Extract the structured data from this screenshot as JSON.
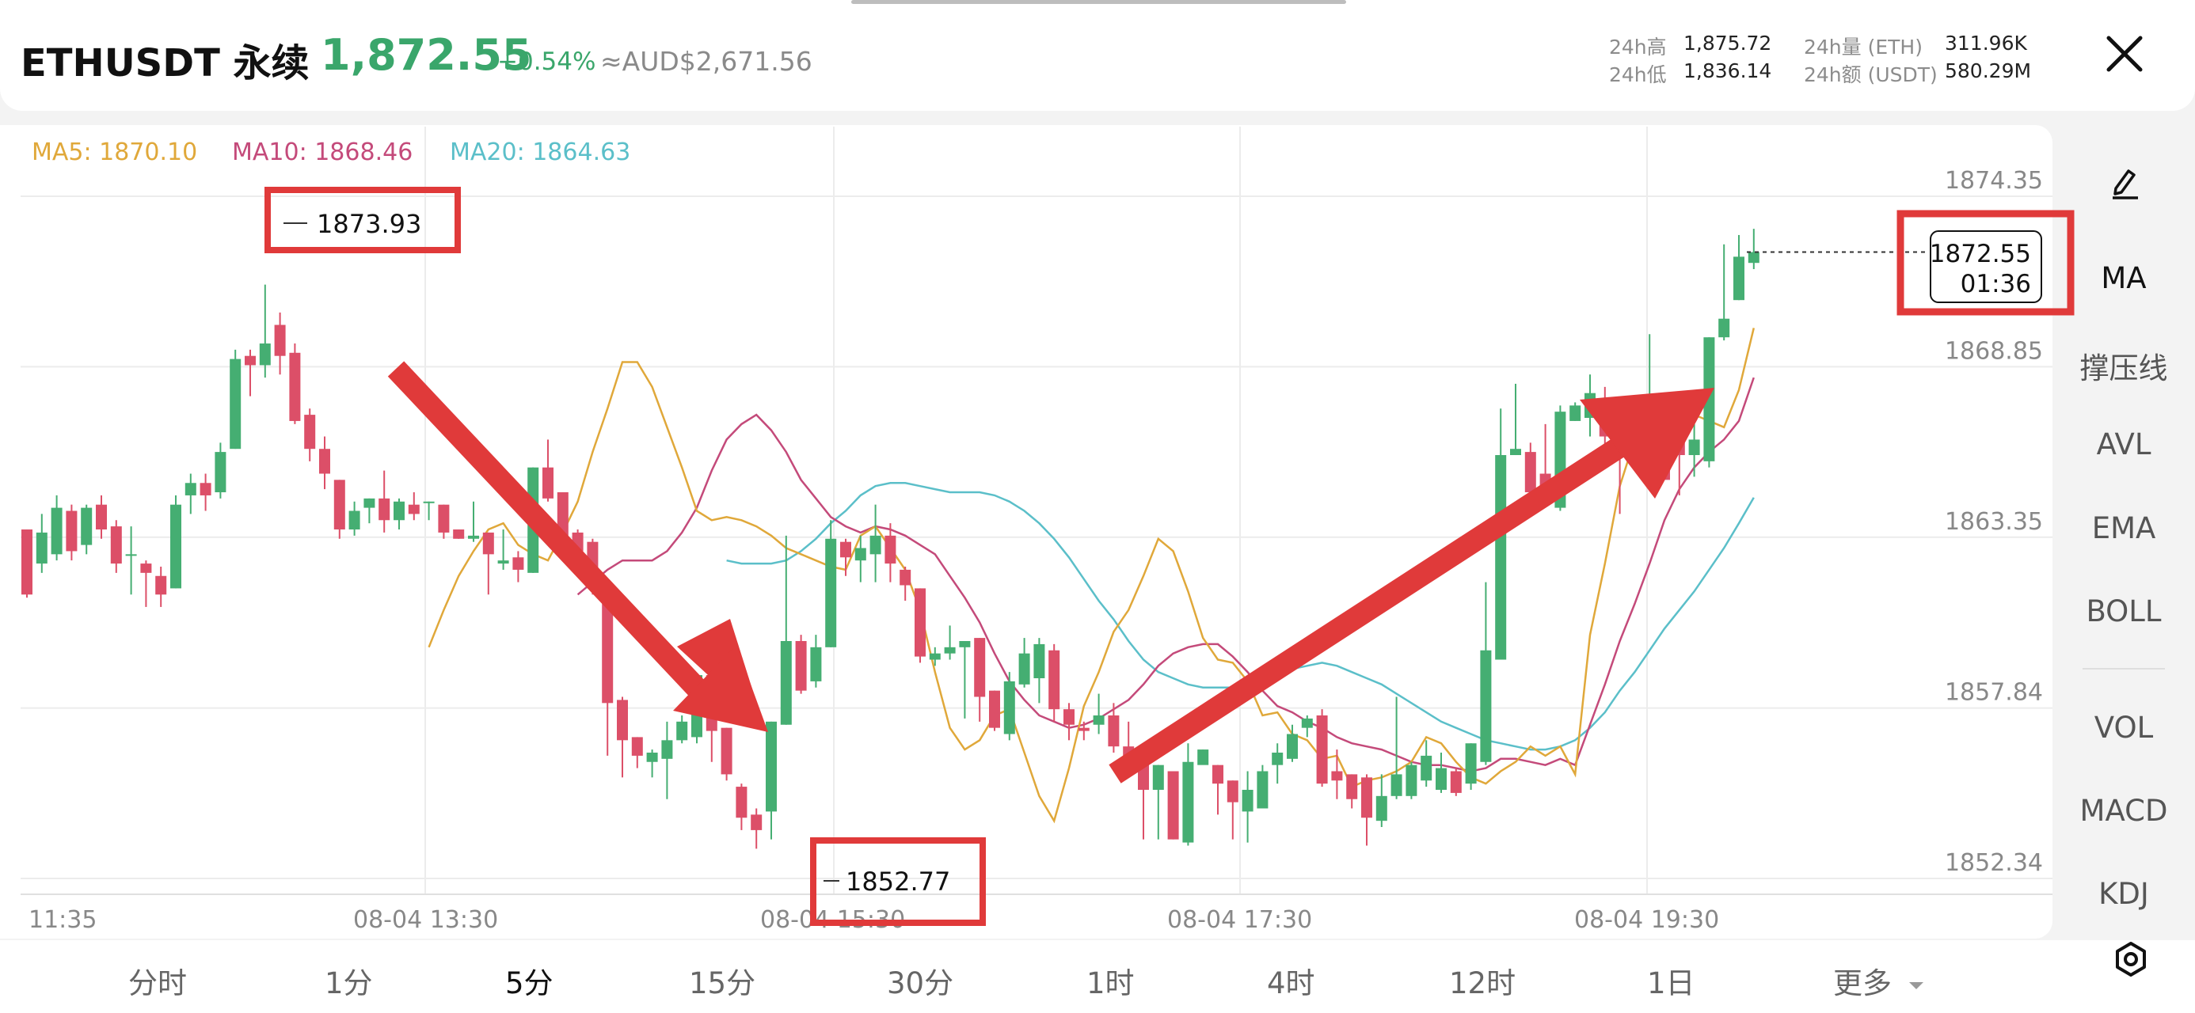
{
  "header": {
    "symbol": "ETHUSDT 永续",
    "price": "1,872.55",
    "change": "+0.54%",
    "aud": "≈AUD$2,671.56",
    "stats": [
      {
        "label": "24h高",
        "value": "1,875.72"
      },
      {
        "label": "24h低",
        "value": "1,836.14"
      },
      {
        "label": "24h量 (ETH)",
        "value": "311.96K"
      },
      {
        "label": "24h额 (USDT)",
        "value": "580.29M"
      }
    ]
  },
  "ma_legend": [
    {
      "label": "MA5: 1870.10",
      "color": "#e0a83a"
    },
    {
      "label": "MA10: 1868.46",
      "color": "#c44a7a"
    },
    {
      "label": "MA20: 1864.63",
      "color": "#5bbfc9"
    }
  ],
  "annotations": {
    "high_label": "1873.93",
    "low_label": "1852.77",
    "last_price": "1872.55",
    "countdown": "01:36"
  },
  "side_menu": [
    "MA",
    "撑压线",
    "AVL",
    "EMA",
    "BOLL",
    "VOL",
    "MACD",
    "KDJ"
  ],
  "timeframes": [
    "分时",
    "1分",
    "5分",
    "15分",
    "30分",
    "1时",
    "4时",
    "12时",
    "1日",
    "更多"
  ],
  "active_timeframe": "5分",
  "colors": {
    "up": "#45ae72",
    "down": "#dc4f68",
    "accent": "#3aa66b",
    "highlight": "#e03a3a"
  },
  "icons": [
    "pencil-icon",
    "close-icon",
    "settings-icon",
    "caret-down-icon"
  ],
  "chart_data": {
    "type": "candlestick",
    "x_ticks": [
      "11:35",
      "08-04 13:30",
      "08-04 15:30",
      "08-04 17:30",
      "08-04 19:30"
    ],
    "y_ticks": [
      "1874.35",
      "1868.85",
      "1863.35",
      "1857.84",
      "1852.34"
    ],
    "ylim": [
      1852.34,
      1874.35
    ],
    "candles": [
      [
        1863.6,
        1861.5,
        1863.6,
        1861.4
      ],
      [
        1862.5,
        1863.5,
        1864.1,
        1862.2
      ],
      [
        1862.8,
        1864.3,
        1864.7,
        1862.6
      ],
      [
        1864.2,
        1862.9,
        1864.4,
        1862.6
      ],
      [
        1863.1,
        1864.3,
        1864.4,
        1862.8
      ],
      [
        1864.4,
        1863.6,
        1864.7,
        1863.3
      ],
      [
        1863.7,
        1862.5,
        1863.9,
        1862.2
      ],
      [
        1862.8,
        1862.8,
        1863.7,
        1861.5
      ],
      [
        1862.5,
        1862.2,
        1862.6,
        1861.1
      ],
      [
        1862.1,
        1861.5,
        1862.4,
        1861.1
      ],
      [
        1861.7,
        1864.4,
        1864.7,
        1861.7
      ],
      [
        1864.7,
        1865.1,
        1865.4,
        1864.1
      ],
      [
        1865.1,
        1864.7,
        1865.4,
        1864.2
      ],
      [
        1864.8,
        1866.1,
        1866.4,
        1864.6
      ],
      [
        1866.2,
        1869.1,
        1869.4,
        1866.2
      ],
      [
        1869.2,
        1868.9,
        1869.4,
        1867.9
      ],
      [
        1868.9,
        1869.6,
        1871.5,
        1868.5
      ],
      [
        1870.2,
        1869.2,
        1870.6,
        1868.6
      ],
      [
        1869.3,
        1867.1,
        1869.6,
        1867.0
      ],
      [
        1867.3,
        1866.2,
        1867.5,
        1865.8
      ],
      [
        1866.2,
        1865.4,
        1866.6,
        1864.9
      ],
      [
        1865.2,
        1863.6,
        1865.2,
        1863.3
      ],
      [
        1863.6,
        1864.2,
        1864.5,
        1863.4
      ],
      [
        1864.3,
        1864.6,
        1864.6,
        1863.8
      ],
      [
        1864.6,
        1863.9,
        1865.5,
        1863.5
      ],
      [
        1863.9,
        1864.5,
        1864.6,
        1863.6
      ],
      [
        1864.4,
        1864.1,
        1864.8,
        1863.9
      ],
      [
        1864.5,
        1864.5,
        1864.5,
        1863.9
      ],
      [
        1864.4,
        1863.5,
        1864.4,
        1863.3
      ],
      [
        1863.6,
        1863.3,
        1863.6,
        1863.3
      ],
      [
        1863.3,
        1863.4,
        1864.5,
        1863.2
      ],
      [
        1863.5,
        1862.8,
        1863.5,
        1861.5
      ],
      [
        1862.5,
        1862.6,
        1863.6,
        1862.3
      ],
      [
        1862.7,
        1862.3,
        1862.9,
        1861.9
      ],
      [
        1862.2,
        1865.6,
        1865.6,
        1862.2
      ],
      [
        1865.6,
        1864.6,
        1866.5,
        1864.5
      ],
      [
        1864.8,
        1863.4,
        1864.8,
        1863.1
      ],
      [
        1863.5,
        1862.9,
        1863.6,
        1862.8
      ],
      [
        1863.2,
        1861.7,
        1863.3,
        1861.5
      ],
      [
        1861.8,
        1858.0,
        1861.8,
        1856.3
      ],
      [
        1858.1,
        1856.8,
        1858.2,
        1855.6
      ],
      [
        1856.9,
        1856.3,
        1856.9,
        1855.9
      ],
      [
        1856.1,
        1856.4,
        1856.5,
        1855.6
      ],
      [
        1856.2,
        1856.8,
        1857.4,
        1854.9
      ],
      [
        1856.8,
        1857.4,
        1857.6,
        1856.7
      ],
      [
        1856.9,
        1858.9,
        1858.9,
        1856.7
      ],
      [
        1858.9,
        1857.1,
        1859.1,
        1856.1
      ],
      [
        1857.2,
        1855.7,
        1857.2,
        1855.5
      ],
      [
        1855.3,
        1854.3,
        1855.4,
        1853.9
      ],
      [
        1854.4,
        1853.9,
        1854.6,
        1853.3
      ],
      [
        1854.5,
        1857.4,
        1857.4,
        1853.6
      ],
      [
        1857.3,
        1860.0,
        1863.4,
        1857.3
      ],
      [
        1860.0,
        1858.4,
        1860.2,
        1858.3
      ],
      [
        1858.7,
        1859.8,
        1860.2,
        1858.5
      ],
      [
        1859.8,
        1863.3,
        1863.9,
        1859.8
      ],
      [
        1863.2,
        1862.7,
        1863.3,
        1862.1
      ],
      [
        1862.6,
        1863.0,
        1863.4,
        1861.9
      ],
      [
        1862.8,
        1863.4,
        1864.4,
        1861.9
      ],
      [
        1863.4,
        1862.5,
        1863.8,
        1861.9
      ],
      [
        1862.3,
        1861.8,
        1862.4,
        1861.3
      ],
      [
        1861.7,
        1859.5,
        1861.7,
        1859.3
      ],
      [
        1859.4,
        1859.6,
        1859.8,
        1859.2
      ],
      [
        1859.6,
        1859.8,
        1860.5,
        1859.4
      ],
      [
        1859.8,
        1860.0,
        1860.0,
        1857.5
      ],
      [
        1860.1,
        1858.2,
        1860.1,
        1857.4
      ],
      [
        1858.4,
        1857.2,
        1858.4,
        1857.1
      ],
      [
        1857.0,
        1858.7,
        1859.0,
        1856.8
      ],
      [
        1858.6,
        1859.6,
        1860.1,
        1858.5
      ],
      [
        1858.8,
        1859.9,
        1860.1,
        1858.0
      ],
      [
        1859.7,
        1857.8,
        1859.9,
        1857.4
      ],
      [
        1857.8,
        1857.3,
        1858.0,
        1856.8
      ],
      [
        1857.2,
        1857.1,
        1857.4,
        1856.8
      ],
      [
        1857.3,
        1857.6,
        1858.3,
        1857.0
      ],
      [
        1857.6,
        1856.6,
        1858.0,
        1856.4
      ],
      [
        1856.6,
        1855.7,
        1857.4,
        1855.7
      ],
      [
        1856.1,
        1855.2,
        1856.6,
        1853.6
      ],
      [
        1855.2,
        1856.0,
        1856.0,
        1853.6
      ],
      [
        1855.8,
        1853.6,
        1855.8,
        1853.6
      ],
      [
        1853.5,
        1856.1,
        1856.7,
        1853.4
      ],
      [
        1856.0,
        1856.5,
        1856.5,
        1856.4
      ],
      [
        1856.0,
        1855.4,
        1856.0,
        1854.4
      ],
      [
        1855.5,
        1854.8,
        1855.5,
        1853.6
      ],
      [
        1854.5,
        1855.2,
        1855.8,
        1853.5
      ],
      [
        1854.6,
        1855.8,
        1856.0,
        1855.1
      ],
      [
        1856.0,
        1856.4,
        1856.7,
        1855.4
      ],
      [
        1856.2,
        1857.0,
        1857.3,
        1856.1
      ],
      [
        1857.2,
        1857.5,
        1857.6,
        1856.9
      ],
      [
        1857.6,
        1855.4,
        1857.8,
        1855.3
      ],
      [
        1855.8,
        1855.5,
        1856.5,
        1854.9
      ],
      [
        1855.7,
        1854.9,
        1855.7,
        1854.6
      ],
      [
        1855.6,
        1854.3,
        1855.7,
        1853.4
      ],
      [
        1854.2,
        1855.0,
        1855.7,
        1854.0
      ],
      [
        1855.0,
        1855.7,
        1858.2,
        1854.9
      ],
      [
        1855.0,
        1856.0,
        1856.1,
        1854.9
      ],
      [
        1855.5,
        1856.3,
        1856.8,
        1855.3
      ],
      [
        1855.2,
        1855.9,
        1856.4,
        1855.1
      ],
      [
        1855.8,
        1855.1,
        1855.9,
        1855.0
      ],
      [
        1855.4,
        1856.7,
        1856.7,
        1855.2
      ],
      [
        1856.1,
        1859.7,
        1861.9,
        1856.0
      ],
      [
        1859.4,
        1866.0,
        1867.5,
        1859.4
      ],
      [
        1866.0,
        1866.2,
        1868.3,
        1866.0
      ],
      [
        1866.1,
        1864.8,
        1866.4,
        1864.3
      ],
      [
        1865.4,
        1864.7,
        1867.0,
        1864.5
      ],
      [
        1864.3,
        1867.4,
        1867.6,
        1864.2
      ],
      [
        1867.1,
        1867.6,
        1867.7,
        1867.1
      ],
      [
        1867.2,
        1868.0,
        1868.6,
        1866.6
      ],
      [
        1867.6,
        1866.6,
        1868.2,
        1865.8
      ],
      [
        1866.7,
        1866.2,
        1866.7,
        1864.1
      ],
      [
        1866.4,
        1867.8,
        1867.9,
        1866.3
      ],
      [
        1866.0,
        1867.7,
        1869.9,
        1865.9
      ],
      [
        1866.6,
        1865.2,
        1866.8,
        1865.6
      ],
      [
        1867.9,
        1866.0,
        1868.0,
        1864.7
      ],
      [
        1866.0,
        1866.5,
        1867.0,
        1865.3
      ],
      [
        1865.8,
        1869.8,
        1869.8,
        1865.6
      ],
      [
        1869.8,
        1870.4,
        1872.8,
        1869.7
      ],
      [
        1871.0,
        1872.4,
        1873.1,
        1871.0
      ],
      [
        1872.2,
        1872.55,
        1873.3,
        1872.0
      ]
    ],
    "ma5": [
      1859.8,
      1861.0,
      1862.1,
      1862.9,
      1863.6,
      1863.8,
      1863.1,
      1862.8,
      1862.6,
      1863.5,
      1864.5,
      1866.1,
      1867.5,
      1869.0,
      1869.0,
      1868.2,
      1866.9,
      1865.6,
      1864.2,
      1863.9,
      1864.0,
      1863.9,
      1863.7,
      1863.4,
      1863.0,
      1862.8,
      1862.6,
      1862.4,
      1862.3,
      1863.4,
      1863.7,
      1863.0,
      1862.3,
      1861.0,
      1859.0,
      1857.2,
      1856.5,
      1856.8,
      1857.6,
      1857.8,
      1856.4,
      1855.0,
      1854.2,
      1855.9,
      1857.9,
      1859.0,
      1860.3,
      1861.0,
      1862.1,
      1863.3,
      1862.9,
      1861.6,
      1860.1,
      1859.4,
      1859.3,
      1858.7,
      1857.6,
      1857.7,
      1857.0,
      1856.8,
      1856.2,
      1856.3,
      1855.3,
      1855.5,
      1855.6,
      1855.8,
      1856.1,
      1856.9,
      1856.7,
      1856.1,
      1855.6,
      1855.4,
      1855.8,
      1856.1,
      1856.6,
      1856.3,
      1856.6,
      1855.7,
      1860.2,
      1862.5,
      1865.0,
      1866.5,
      1867.2,
      1867.3,
      1867.0,
      1867.3,
      1867.1,
      1866.9,
      1868.1,
      1870.1
    ],
    "ma10": [
      1861.5,
      1861.9,
      1862.3,
      1862.6,
      1862.6,
      1862.6,
      1862.9,
      1863.5,
      1864.3,
      1865.5,
      1866.5,
      1867.0,
      1867.3,
      1866.8,
      1866.1,
      1865.2,
      1864.6,
      1864.0,
      1863.7,
      1863.5,
      1863.7,
      1863.6,
      1863.4,
      1863.1,
      1862.8,
      1862.1,
      1861.4,
      1860.6,
      1859.6,
      1858.7,
      1858.1,
      1857.6,
      1857.4,
      1857.2,
      1857.3,
      1857.5,
      1857.8,
      1858.1,
      1858.6,
      1859.2,
      1859.6,
      1859.8,
      1859.9,
      1859.9,
      1859.5,
      1859.0,
      1858.4,
      1857.9,
      1857.7,
      1857.4,
      1857.2,
      1856.9,
      1856.7,
      1856.6,
      1856.5,
      1856.3,
      1856.1,
      1856.0,
      1856.0,
      1855.9,
      1855.8,
      1855.9,
      1856.2,
      1856.2,
      1856.1,
      1856.0,
      1856.2,
      1856.0,
      1857.3,
      1858.6,
      1860.0,
      1861.2,
      1862.5,
      1863.9,
      1864.9,
      1865.6,
      1866.1,
      1866.5,
      1867.1,
      1868.5
    ],
    "ma20": [
      1862.6,
      1862.5,
      1862.5,
      1862.5,
      1862.6,
      1862.9,
      1863.3,
      1863.8,
      1864.2,
      1864.7,
      1865.0,
      1865.1,
      1865.1,
      1865.0,
      1864.9,
      1864.8,
      1864.8,
      1864.8,
      1864.7,
      1864.5,
      1864.2,
      1863.8,
      1863.3,
      1862.7,
      1862.0,
      1861.3,
      1860.7,
      1860.0,
      1859.4,
      1859.0,
      1858.8,
      1858.6,
      1858.5,
      1858.5,
      1858.5,
      1858.6,
      1858.8,
      1859.0,
      1859.1,
      1859.2,
      1859.3,
      1859.2,
      1859.0,
      1858.8,
      1858.6,
      1858.3,
      1858.0,
      1857.7,
      1857.4,
      1857.2,
      1857.0,
      1856.8,
      1856.7,
      1856.6,
      1856.5,
      1856.5,
      1856.6,
      1856.8,
      1857.2,
      1857.7,
      1858.4,
      1859.0,
      1859.7,
      1860.4,
      1861.0,
      1861.6,
      1862.3,
      1863.0,
      1863.8,
      1864.63
    ]
  }
}
